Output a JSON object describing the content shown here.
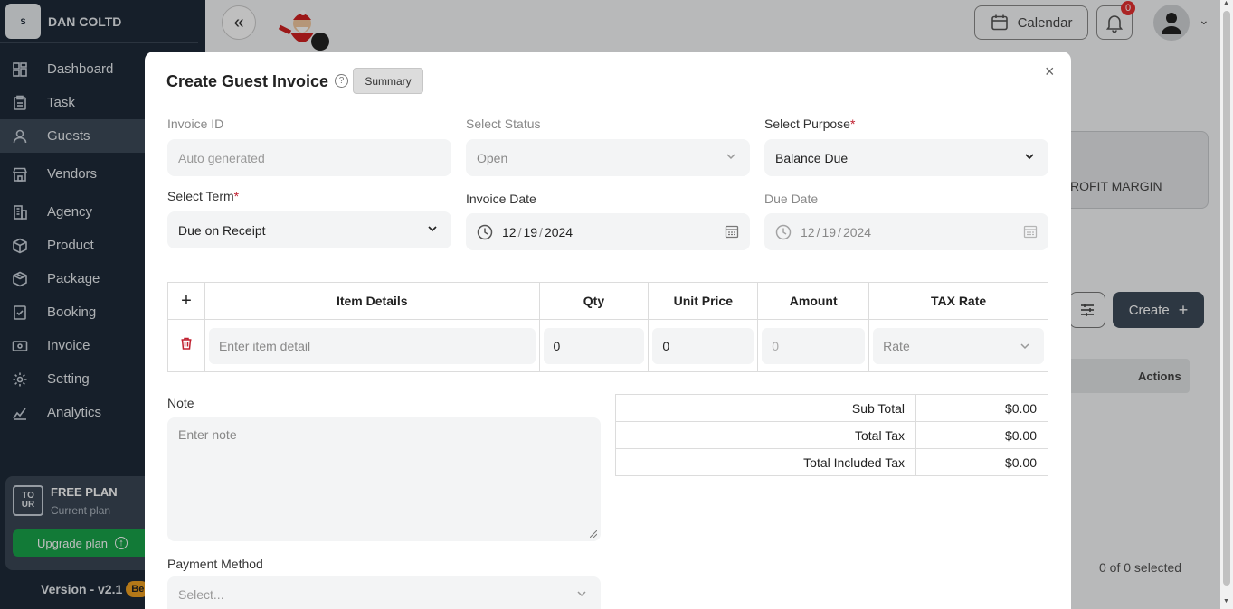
{
  "sidebar": {
    "brand": "DAN COLTD",
    "logo_text": "S",
    "items": [
      {
        "label": "Dashboard",
        "icon": "dashboard-icon"
      },
      {
        "label": "Task",
        "icon": "clipboard-icon"
      },
      {
        "label": "Guests",
        "icon": "user-icon",
        "active": true
      },
      {
        "label": "Vendors",
        "icon": "store-icon"
      },
      {
        "label": "Agency",
        "icon": "building-icon"
      },
      {
        "label": "Product",
        "icon": "box-icon"
      },
      {
        "label": "Package",
        "icon": "package-icon"
      },
      {
        "label": "Booking",
        "icon": "booking-icon"
      },
      {
        "label": "Invoice",
        "icon": "invoice-icon"
      },
      {
        "label": "Setting",
        "icon": "gear-icon"
      },
      {
        "label": "Analytics",
        "icon": "analytics-icon"
      }
    ],
    "plan": {
      "icon_text": "TO UR",
      "title": "FREE PLAN",
      "subtitle": "Current plan",
      "upgrade_label": "Upgrade plan"
    },
    "version": "Version - v2.1",
    "badge": "Be"
  },
  "header": {
    "calendar_label": "Calendar",
    "notification_count": "0"
  },
  "background": {
    "profit_label": "ROFIT MARGIN",
    "create_label": "Create",
    "actions_label": "Actions",
    "selected_label": "0 of 0 selected"
  },
  "modal": {
    "title": "Create Guest Invoice",
    "summary_label": "Summary",
    "close_label": "×",
    "invoice_id": {
      "label": "Invoice ID",
      "placeholder": "Auto generated"
    },
    "status": {
      "label": "Select Status",
      "value": "Open"
    },
    "purpose": {
      "label": "Select Purpose",
      "value": "Balance Due"
    },
    "term": {
      "label": "Select Term",
      "value": "Due on Receipt"
    },
    "invoice_date": {
      "label": "Invoice Date",
      "month": "12",
      "day": "19",
      "year": "2024"
    },
    "due_date": {
      "label": "Due Date",
      "month": "12",
      "day": "19",
      "year": "2024"
    },
    "items_table": {
      "headers": [
        "+",
        "Item Details",
        "Qty",
        "Unit Price",
        "Amount",
        "TAX Rate"
      ],
      "row": {
        "item_placeholder": "Enter item detail",
        "qty": "0",
        "unit_price": "0",
        "amount": "0",
        "tax_placeholder": "Rate"
      }
    },
    "totals": [
      {
        "label": "Sub Total",
        "value": "$0.00"
      },
      {
        "label": "Total Tax",
        "value": "$0.00"
      },
      {
        "label": "Total Included Tax",
        "value": "$0.00"
      }
    ],
    "note": {
      "label": "Note",
      "placeholder": "Enter note"
    },
    "payment_method": {
      "label": "Payment Method",
      "placeholder": "Select..."
    }
  },
  "colors": {
    "sidebar": "#1e2a38",
    "accent": "#3d4a59",
    "upgrade": "#19a34a",
    "required": "#c02030",
    "delete": "#c02030"
  }
}
